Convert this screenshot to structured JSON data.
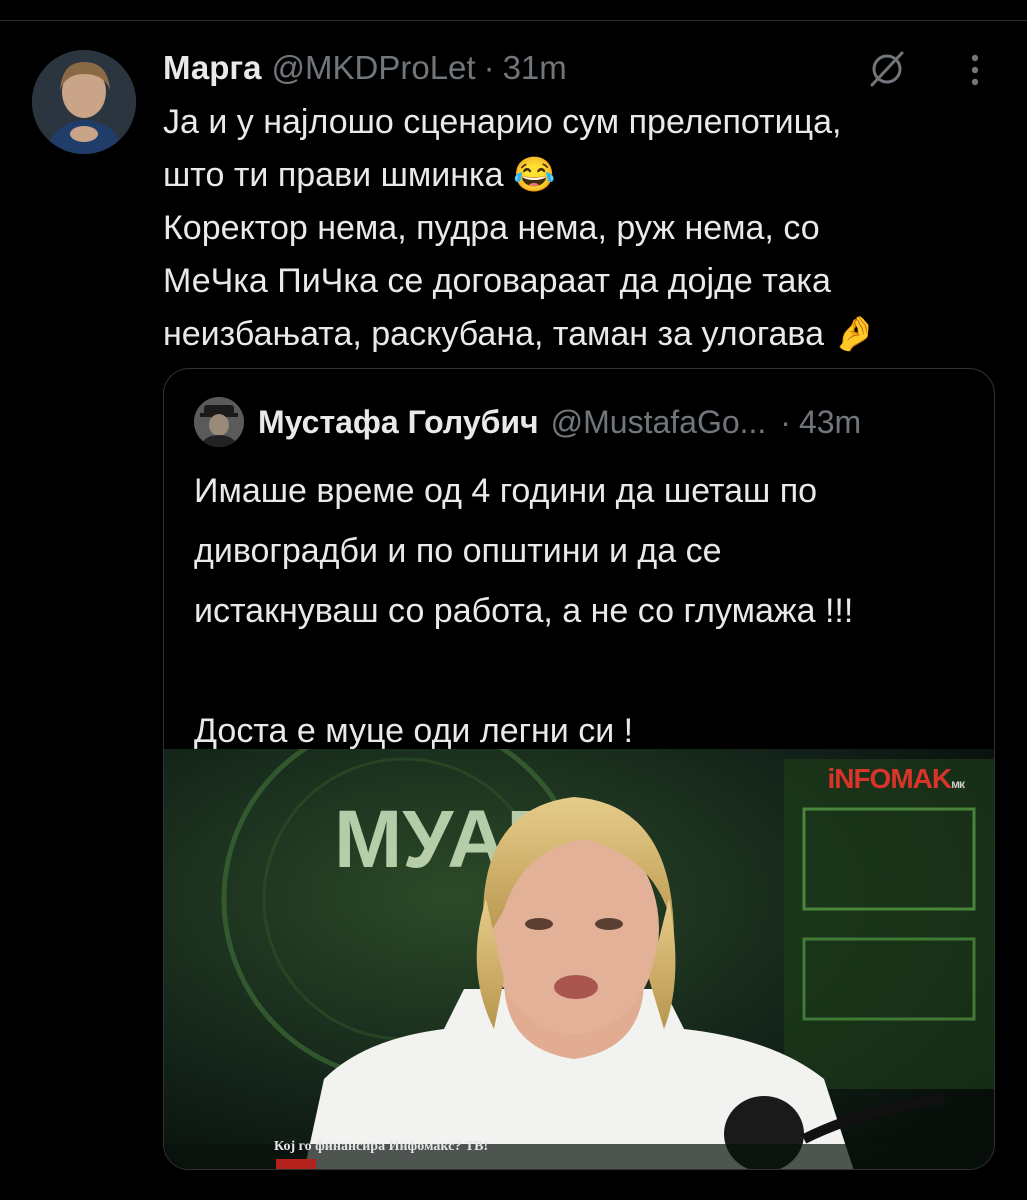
{
  "tweet": {
    "author_name": "Марга",
    "handle": "@MKDProLet",
    "separator": "·",
    "time": "31m",
    "text_lines": [
      "Ја и у најлошо сценарио сум прелепотица,",
      "што ти прави шминка 😂",
      "Коректор нема, пудра нема, руж нема, со",
      "МеЧка ПиЧка се договараат да дојде така",
      "неизбањата, раскубана, таман за улогава 🤌"
    ]
  },
  "icons": {
    "grok": "grok-icon",
    "more": "more-options-icon"
  },
  "quote": {
    "author_name": "Мустафа Голубич",
    "handle": "@MustafaGo...",
    "separator": "·",
    "time": "43m",
    "text_lines": [
      "Имаше време од 4 години да шеташ по",
      "дивоградби и по општини и да се",
      "истакнуваш со работа, а не со глумажа !!!",
      "",
      "Доста е муце оди легни си !"
    ],
    "image": {
      "show_title": "МУАБЕ",
      "watermark": "iNFOMAK",
      "watermark_suffix": "мк",
      "ticker": "Кој го финансира Инфомакс? ТВ!"
    }
  },
  "colors": {
    "background": "#000000",
    "text": "#e7e9ea",
    "muted": "#71767b",
    "border": "#2f3336"
  }
}
